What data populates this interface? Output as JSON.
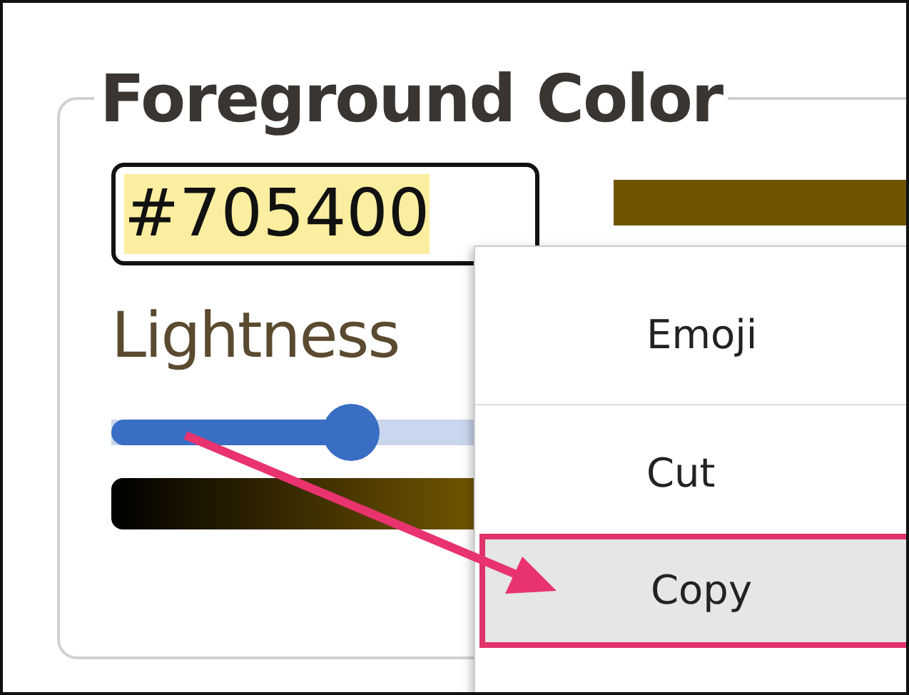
{
  "color_panel": {
    "legend": "Foreground Color",
    "hex_field": {
      "value": "#705400",
      "text_selected": true
    },
    "lightness": {
      "label": "Lightness",
      "level": 0.3
    }
  },
  "context_menu": {
    "items": [
      {
        "kind": "item",
        "label": "Emoji",
        "selected": false
      },
      {
        "kind": "separator"
      },
      {
        "kind": "item",
        "label": "Cut",
        "selected": false
      },
      {
        "kind": "item",
        "label": "Copy",
        "selected": true
      }
    ]
  }
}
